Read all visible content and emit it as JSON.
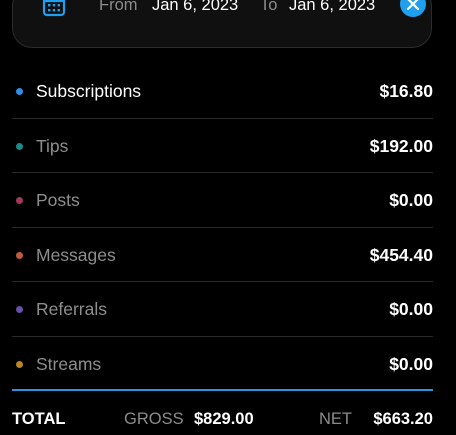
{
  "date_range": {
    "from_label": "From",
    "from_value": "Jan 6, 2023",
    "to_label": "To",
    "to_value": "Jan 6, 2023",
    "calendar_icon": "calendar-icon",
    "clear_icon": "close-icon",
    "accent_color": "#1e9ff0"
  },
  "categories": [
    {
      "label": "Subscriptions",
      "value": "$16.80",
      "dot_color": "#2f8ee6",
      "active": true
    },
    {
      "label": "Tips",
      "value": "$192.00",
      "dot_color": "#1c8a8a",
      "active": false
    },
    {
      "label": "Posts",
      "value": "$0.00",
      "dot_color": "#a8365c",
      "active": false
    },
    {
      "label": "Messages",
      "value": "$454.40",
      "dot_color": "#c05a3a",
      "active": false
    },
    {
      "label": "Referrals",
      "value": "$0.00",
      "dot_color": "#6a4fa8",
      "active": false
    },
    {
      "label": "Streams",
      "value": "$0.00",
      "dot_color": "#b8861e",
      "active": false
    }
  ],
  "total": {
    "label": "TOTAL",
    "gross_label": "GROSS",
    "gross_value": "$829.00",
    "net_label": "NET",
    "net_value": "$663.20"
  }
}
